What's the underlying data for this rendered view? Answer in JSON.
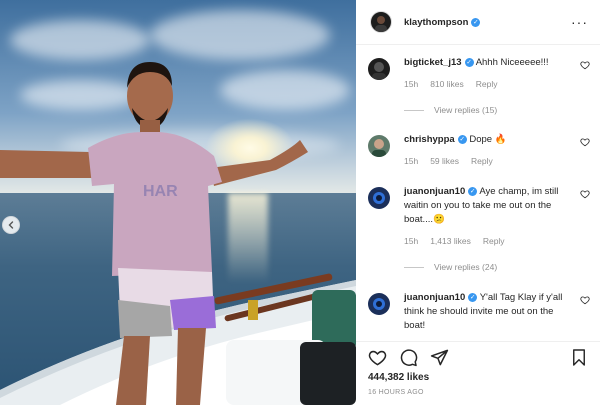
{
  "post": {
    "author": "klaythompson",
    "likes": "444,382 likes",
    "timestamp": "16 HOURS AGO",
    "more_icon": "more-horizontal-icon",
    "shirt_text": "HAR"
  },
  "comments": [
    {
      "user": "bigticket_j13",
      "text": "Ahhh Niceeeee!!!",
      "time": "15h",
      "likes": "810 likes",
      "reply": "Reply",
      "view_replies": "View replies (15)"
    },
    {
      "user": "chrishyppa",
      "text": "Dope 🔥",
      "time": "15h",
      "likes": "59 likes",
      "reply": "Reply"
    },
    {
      "user": "juanonjuan10",
      "text": "Aye champ, im still waitin on you to take me out on the boat....😕",
      "time": "15h",
      "likes": "1,413 likes",
      "reply": "Reply",
      "view_replies": "View replies (24)"
    },
    {
      "user": "juanonjuan10",
      "text": "Y'all Tag Klay if y'all think he should invite me out on the boat!"
    }
  ],
  "icons": {
    "like": "heart-icon",
    "comment": "comment-icon",
    "share": "paper-plane-icon",
    "save": "bookmark-icon",
    "verified": "verified-badge-icon",
    "carousel_prev": "chevron-left-icon"
  },
  "colors": {
    "verified_blue": "#3897f0",
    "meta_gray": "#8e8e8e",
    "text": "#262626"
  }
}
